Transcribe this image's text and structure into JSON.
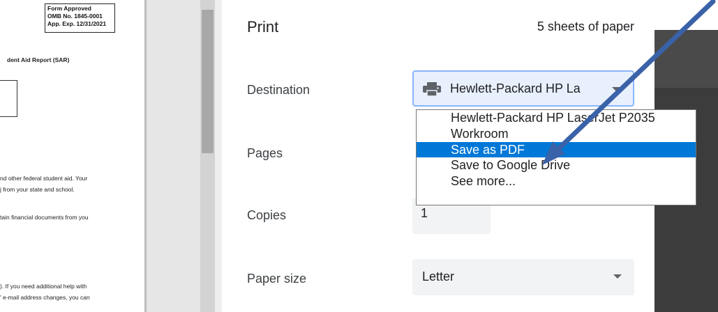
{
  "document": {
    "form_box": [
      "Form Approved",
      "OMB No. 1845-0001",
      "App. Exp. 12/31/2021"
    ],
    "report_title": "dent Aid Report (SAR)",
    "lines": [
      "nd other federal student aid.  Your",
      "j from your state and school.",
      "tain financial documents from you",
      "). If you need additional help with",
      "' e-mail address changes, you can"
    ]
  },
  "print_dialog": {
    "title": "Print",
    "sheet_count": "5 sheets of paper",
    "destination": {
      "label": "Destination",
      "value": "Hewlett-Packard HP La",
      "icon": "printer-icon",
      "options": [
        "Hewlett-Packard HP LaserJet P2035",
        "Workroom",
        "Save as PDF",
        "Save to Google Drive",
        "See more..."
      ],
      "selected_index": 2
    },
    "pages": {
      "label": "Pages"
    },
    "copies": {
      "label": "Copies",
      "value": "1"
    },
    "paper_size": {
      "label": "Paper size",
      "value": "Letter"
    }
  },
  "colors": {
    "highlight": "#0078d7",
    "arrow": "#3a62a8",
    "focus_border": "#8ab4f8"
  }
}
